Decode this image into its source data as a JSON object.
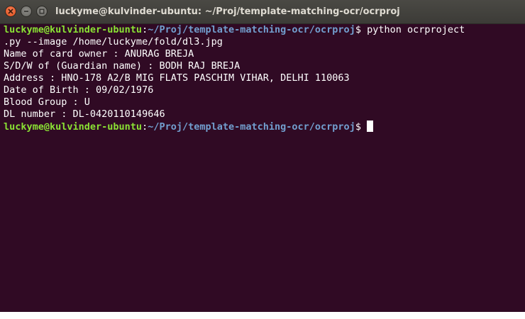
{
  "window": {
    "title": "luckyme@kulvinder-ubuntu: ~/Proj/template-matching-ocr/ocrproj"
  },
  "controls": {
    "close_icon": "close-icon",
    "minimize_icon": "minimize-icon",
    "maximize_icon": "maximize-icon"
  },
  "terminal": {
    "prompt_user": "luckyme@kulvinder-ubuntu",
    "prompt_colon": ":",
    "prompt_path": "~/Proj/template-matching-ocr/ocrproj",
    "prompt_symbol": "$ ",
    "command_part1": "python ocrproject",
    "command_part2": ".py --image /home/luckyme/fold/dl3.jpg",
    "output": [
      "Name of card owner : ANURAG BREJA",
      "S/D/W of (Guardian name) : BODH RAJ BREJA",
      "Address : HNO-178 A2/B MIG FLATS PASCHIM VIHAR, DELHI 110063",
      "Date of Birth : 09/02/1976",
      "Blood Group : U",
      "DL number : DL-0420110149646"
    ]
  },
  "colors": {
    "terminal_bg": "#300a24",
    "prompt_user": "#8ae234",
    "prompt_path": "#729fcf",
    "close_button": "#df4b16"
  }
}
